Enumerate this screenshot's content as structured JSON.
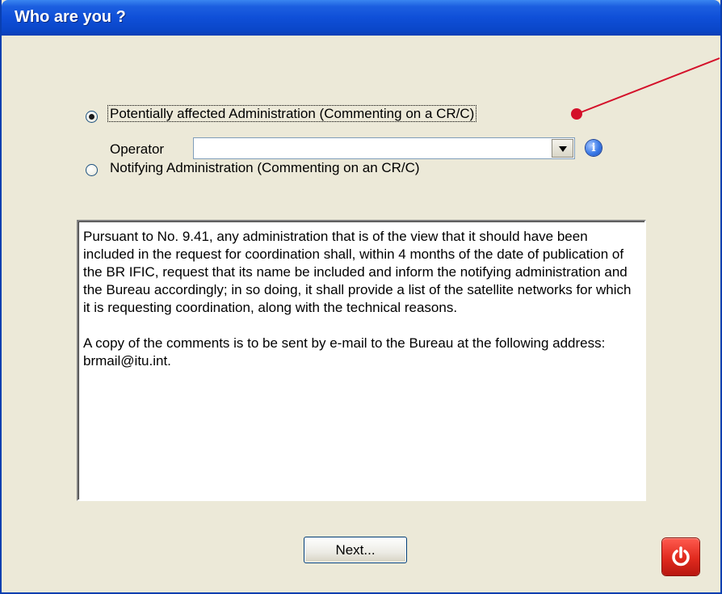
{
  "window": {
    "title": "Who are you ?"
  },
  "roles": {
    "affected_label": "Potentially affected Administration (Commenting on a CR/C)",
    "affected_checked": true,
    "notifying_label": "Notifying Administration (Commenting on an CR/C)",
    "notifying_checked": false
  },
  "operator": {
    "label": "Operator",
    "value": ""
  },
  "description": {
    "paragraph1": "Pursuant to No. 9.41, any administration that is of the view that it should have been included in the request for coordination shall, within 4 months of the date of publication of the BR IFIC, request that its name be included and inform the notifying administration and the Bureau accordingly; in so doing, it shall provide a list of the satellite networks for which it is requesting coordination, along with the technical reasons.",
    "paragraph2": "A copy of the comments is to be sent by e-mail to the Bureau at the following address: brmail@itu.int."
  },
  "buttons": {
    "next_label": "Next..."
  },
  "icons": {
    "info": "info-icon",
    "power": "power-icon",
    "dropdown": "chevron-down-icon"
  },
  "colors": {
    "title_bar": "#0f4fd8",
    "annotation": "#d4102a",
    "power_button": "#e02a1e"
  }
}
